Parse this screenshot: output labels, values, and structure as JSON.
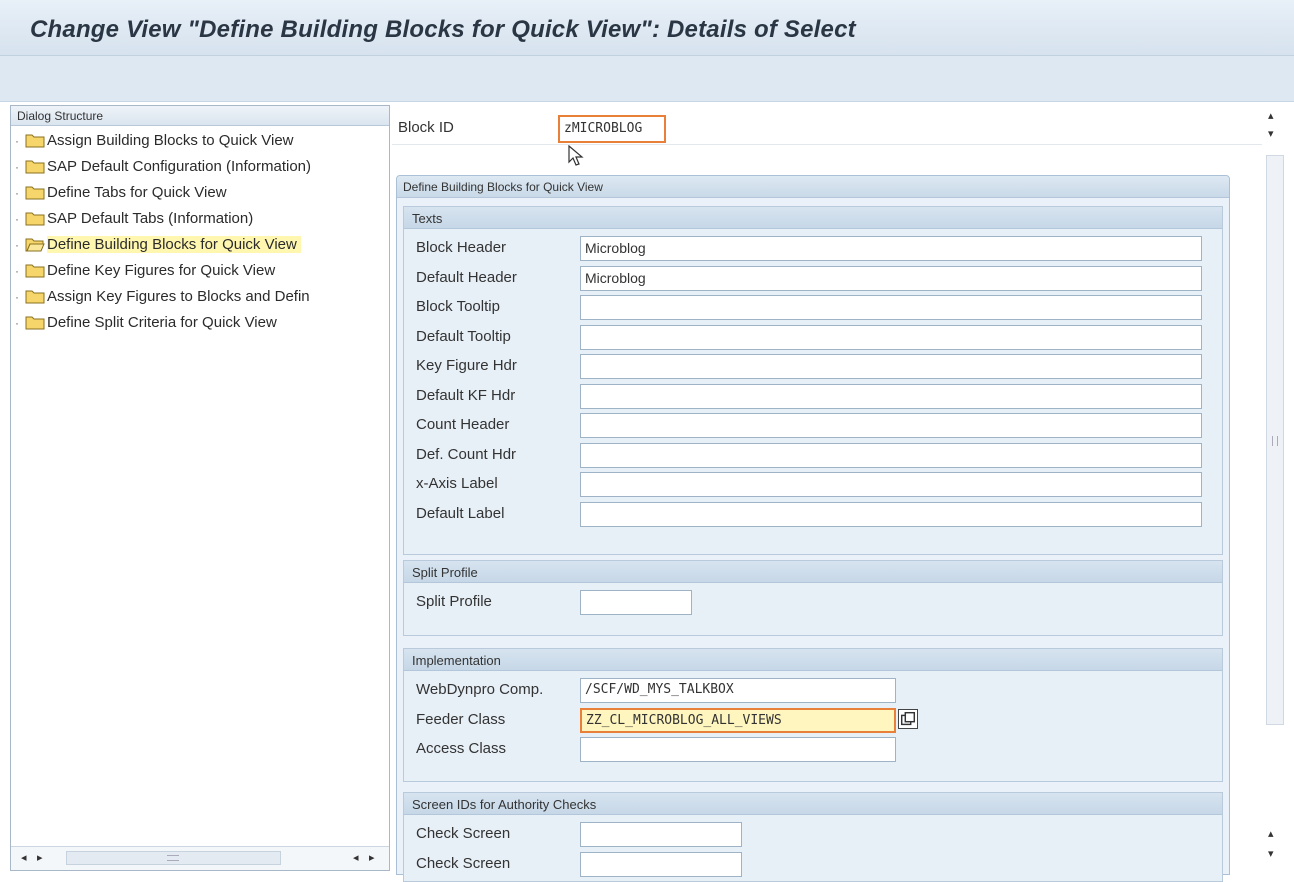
{
  "window": {
    "title": "Change View \"Define Building Blocks for Quick View\": Details of Select"
  },
  "dialog_structure": {
    "header": "Dialog Structure",
    "items": [
      {
        "label": "Assign Building Blocks to Quick View",
        "selected": false
      },
      {
        "label": "SAP Default Configuration (Information)",
        "selected": false
      },
      {
        "label": "Define Tabs for Quick View",
        "selected": false
      },
      {
        "label": "SAP Default Tabs (Information)",
        "selected": false
      },
      {
        "label": "Define Building Blocks for Quick View",
        "selected": true
      },
      {
        "label": "Define Key Figures for Quick View",
        "selected": false
      },
      {
        "label": "Assign Key Figures to Blocks and Defin",
        "selected": false
      },
      {
        "label": "Define Split Criteria for Quick View",
        "selected": false
      }
    ]
  },
  "block_id": {
    "label": "Block ID",
    "value": "zMICROBLOG"
  },
  "main_group": {
    "header": "Define Building Blocks for Quick View"
  },
  "texts": {
    "header": "Texts",
    "fields": [
      {
        "label": "Block Header",
        "value": "Microblog"
      },
      {
        "label": "Default Header",
        "value": "Microblog"
      },
      {
        "label": "Block Tooltip",
        "value": ""
      },
      {
        "label": "Default Tooltip",
        "value": ""
      },
      {
        "label": "Key Figure Hdr",
        "value": ""
      },
      {
        "label": "Default KF Hdr",
        "value": ""
      },
      {
        "label": "Count Header",
        "value": ""
      },
      {
        "label": "Def. Count Hdr",
        "value": ""
      },
      {
        "label": "x-Axis Label",
        "value": ""
      },
      {
        "label": "Default Label",
        "value": ""
      }
    ]
  },
  "split_profile": {
    "header": "Split Profile",
    "label": "Split Profile",
    "value": ""
  },
  "implementation": {
    "header": "Implementation",
    "webdynpro": {
      "label": "WebDynpro Comp.",
      "value": "/SCF/WD_MYS_TALKBOX"
    },
    "feeder": {
      "label": "Feeder Class",
      "value": "ZZ_CL_MICROBLOG_ALL_VIEWS"
    },
    "access": {
      "label": "Access Class",
      "value": ""
    }
  },
  "authority": {
    "header": "Screen IDs for Authority Checks",
    "fields": [
      {
        "label": "Check Screen",
        "value": ""
      },
      {
        "label": "Check Screen",
        "value": ""
      }
    ]
  },
  "colors": {
    "highlight_border": "#e8803a",
    "selected_bg": "#fff7b0",
    "panel_bg": "#e7eff7"
  }
}
